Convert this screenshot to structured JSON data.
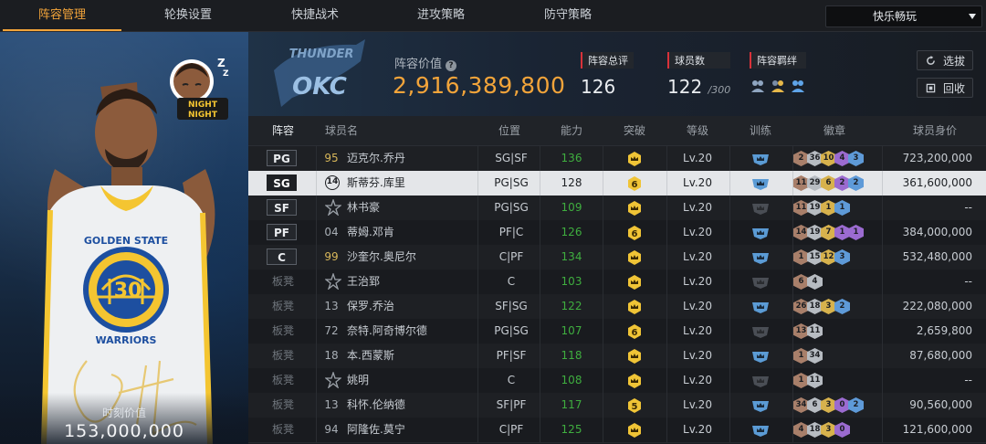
{
  "tabs": [
    "阵容管理",
    "轮换设置",
    "快捷战术",
    "进攻策略",
    "防守策略"
  ],
  "mode_select": "快乐畅玩",
  "card": {
    "caption": "时刻价值",
    "value": "153,000,000",
    "jersey": "30",
    "team_text": "GOLDEN STATE",
    "team_text2": "WARRIORS",
    "sticker_text1": "NIGHT",
    "sticker_text2": "NIGHT"
  },
  "header": {
    "logo_text": "OKC",
    "logo_text_top": "THUNDER",
    "lineup_value_label": "阵容价值",
    "lineup_value": "2,916,389,800",
    "overall_label": "阵容总评",
    "overall_value": "126",
    "players_label": "球员数",
    "players_value": "122",
    "players_max": "/300",
    "bond_label": "阵容羁绊",
    "select_btn": "选拔",
    "recycle_btn": "回收"
  },
  "columns": [
    "阵容",
    "球员名",
    "位置",
    "能力",
    "突破",
    "等级",
    "训练",
    "徽章",
    "球员身价"
  ],
  "rows": [
    {
      "slot": "PG",
      "num": "95",
      "num_style": "gold",
      "name": "迈克尔.乔丹",
      "pos": "SG|SF",
      "rating": "136",
      "break": "crown",
      "level": "Lv.20",
      "train": "blue",
      "badges": [
        [
          "bronze",
          "2"
        ],
        [
          "silver",
          "36"
        ],
        [
          "gold",
          "10"
        ],
        [
          "purple",
          "4"
        ],
        [
          "blue",
          "3"
        ]
      ],
      "price": "723,200,000"
    },
    {
      "slot": "SG",
      "num": "14",
      "num_style": "badge",
      "name": "斯蒂芬.库里",
      "pos": "PG|SG",
      "rating": "128",
      "break": "6",
      "level": "Lv.20",
      "train": "blue",
      "badges": [
        [
          "bronze",
          "11"
        ],
        [
          "silver",
          "29"
        ],
        [
          "gold",
          "6"
        ],
        [
          "purple",
          "2"
        ],
        [
          "blue",
          "2"
        ]
      ],
      "price": "361,600,000",
      "selected": true
    },
    {
      "slot": "SF",
      "num": "",
      "num_style": "star",
      "name": "林书豪",
      "pos": "PG|SG",
      "rating": "109",
      "break": "crown",
      "level": "Lv.20",
      "train": "grey",
      "badges": [
        [
          "bronze",
          "11"
        ],
        [
          "silver",
          "19"
        ],
        [
          "gold",
          "1"
        ],
        [
          "blue",
          "1"
        ]
      ],
      "price": "--"
    },
    {
      "slot": "PF",
      "num": "04",
      "num_style": "plain",
      "name": "蒂姆.邓肯",
      "pos": "PF|C",
      "rating": "126",
      "break": "6",
      "level": "Lv.20",
      "train": "blue",
      "badges": [
        [
          "bronze",
          "14"
        ],
        [
          "silver",
          "19"
        ],
        [
          "gold",
          "7"
        ],
        [
          "purple",
          "1"
        ],
        [
          "purple",
          "1"
        ]
      ],
      "price": "384,000,000"
    },
    {
      "slot": "C",
      "num": "99",
      "num_style": "gold",
      "name": "沙奎尔.奥尼尔",
      "pos": "C|PF",
      "rating": "134",
      "break": "crown",
      "level": "Lv.20",
      "train": "blue",
      "badges": [
        [
          "bronze",
          "1"
        ],
        [
          "silver",
          "15"
        ],
        [
          "gold",
          "12"
        ],
        [
          "blue",
          "3"
        ]
      ],
      "price": "532,480,000"
    },
    {
      "slot": "板凳",
      "num": "",
      "num_style": "star",
      "name": "王治郅",
      "pos": "C",
      "rating": "103",
      "break": "crown",
      "level": "Lv.20",
      "train": "grey",
      "badges": [
        [
          "bronze",
          "6"
        ],
        [
          "silver",
          "4"
        ]
      ],
      "price": "--"
    },
    {
      "slot": "板凳",
      "num": "13",
      "num_style": "plain",
      "name": "保罗.乔治",
      "pos": "SF|SG",
      "rating": "122",
      "break": "crown",
      "level": "Lv.20",
      "train": "blue",
      "badges": [
        [
          "bronze",
          "26"
        ],
        [
          "silver",
          "18"
        ],
        [
          "gold",
          "3"
        ],
        [
          "blue",
          "2"
        ]
      ],
      "price": "222,080,000"
    },
    {
      "slot": "板凳",
      "num": "72",
      "num_style": "plain",
      "name": "奈特.阿奇博尔德",
      "pos": "PG|SG",
      "rating": "107",
      "break": "6",
      "level": "Lv.20",
      "train": "grey",
      "badges": [
        [
          "bronze",
          "13"
        ],
        [
          "silver",
          "11"
        ]
      ],
      "price": "2,659,800"
    },
    {
      "slot": "板凳",
      "num": "18",
      "num_style": "plain",
      "name": "本.西蒙斯",
      "pos": "PF|SF",
      "rating": "118",
      "break": "crown",
      "level": "Lv.20",
      "train": "blue",
      "badges": [
        [
          "bronze",
          "1"
        ],
        [
          "silver",
          "34"
        ]
      ],
      "price": "87,680,000"
    },
    {
      "slot": "板凳",
      "num": "",
      "num_style": "star",
      "name": "姚明",
      "pos": "C",
      "rating": "108",
      "break": "crown",
      "level": "Lv.20",
      "train": "grey",
      "badges": [
        [
          "bronze",
          "1"
        ],
        [
          "silver",
          "11"
        ]
      ],
      "price": "--"
    },
    {
      "slot": "板凳",
      "num": "13",
      "num_style": "plain",
      "name": "科怀.伦纳德",
      "pos": "SF|PF",
      "rating": "117",
      "break": "5",
      "level": "Lv.20",
      "train": "blue",
      "badges": [
        [
          "bronze",
          "34"
        ],
        [
          "silver",
          "6"
        ],
        [
          "gold",
          "3"
        ],
        [
          "purple",
          "0"
        ],
        [
          "blue",
          "2"
        ]
      ],
      "price": "90,560,000"
    },
    {
      "slot": "板凳",
      "num": "94",
      "num_style": "plain",
      "name": "阿隆佐.莫宁",
      "pos": "C|PF",
      "rating": "125",
      "break": "crown",
      "level": "Lv.20",
      "train": "blue",
      "badges": [
        [
          "bronze",
          "4"
        ],
        [
          "silver",
          "18"
        ],
        [
          "gold",
          "3"
        ],
        [
          "purple",
          "0"
        ]
      ],
      "price": "121,600,000"
    }
  ],
  "colors": {
    "accent": "#f2a43a",
    "green": "#3fae3f",
    "red_tag": "#d9323a"
  }
}
